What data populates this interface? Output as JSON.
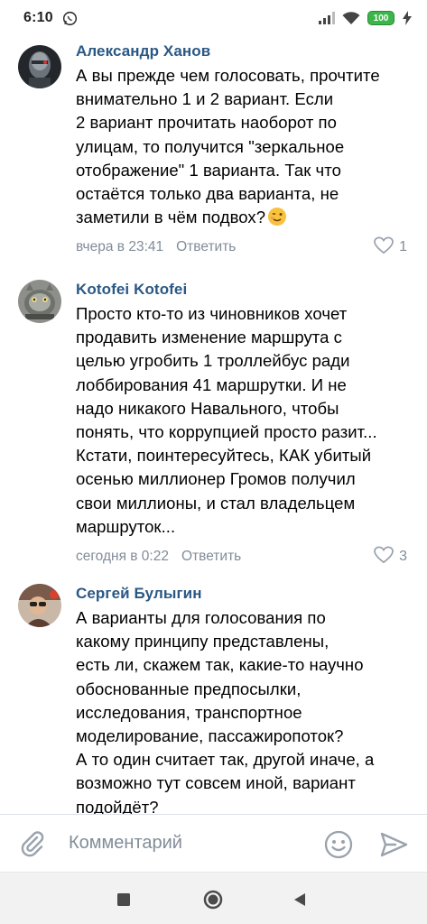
{
  "status_bar": {
    "time": "6:10",
    "battery": "100",
    "icons": [
      "whatsapp-icon",
      "signal-icon",
      "wifi-icon",
      "battery-icon",
      "charging-icon"
    ]
  },
  "comments": [
    {
      "author": "Александр Ханов",
      "text": "А вы прежде чем голосовать, прочтите\nвнимательно 1 и 2 вариант. Если\n2 вариант прочитать наоборот по\nулицам, то получится \"зеркальное\nотображение\" 1 варианта. Так что\nостаётся только два варианта, не\nзаметили в чём подвох?",
      "emoji": "winking-face-icon",
      "time": "вчера в 23:41",
      "reply_label": "Ответить",
      "likes": "1"
    },
    {
      "author": "Kotofei Kotofei",
      "text": "Просто кто-то из чиновников хочет\nпродавить изменение маршрута с\nцелью угробить 1 троллейбус ради\nлоббирования 41 маршрутки. И не\nнадо никакого Навального, чтобы\nпонять, что коррупцией просто разит...\nКстати, поинтересуйтесь, КАК убитый\nосенью миллионер Громов получил\nсвои миллионы, и стал владельцем\nмаршруток...",
      "time": "сегодня в 0:22",
      "reply_label": "Ответить",
      "likes": "3"
    },
    {
      "author": "Сергей Булыгин",
      "text": "А варианты для голосования по\nкакому принципу представлены,\nесть ли, скажем так, какие-то научно\nобоснованные предпосылки,\nисследования, транспортное\nмоделирование, пассажиропоток?\nА то один считает так, другой иначе, а\nвозможно тут совсем иной, вариант\nподойдёт?"
    }
  ],
  "composer": {
    "placeholder": "Комментарий"
  },
  "colors": {
    "author_link": "#2a5885",
    "secondary_text": "#818c99",
    "accent_icon": "#99a2ad",
    "divider": "#dce1e6",
    "battery_green": "#3db54a"
  }
}
